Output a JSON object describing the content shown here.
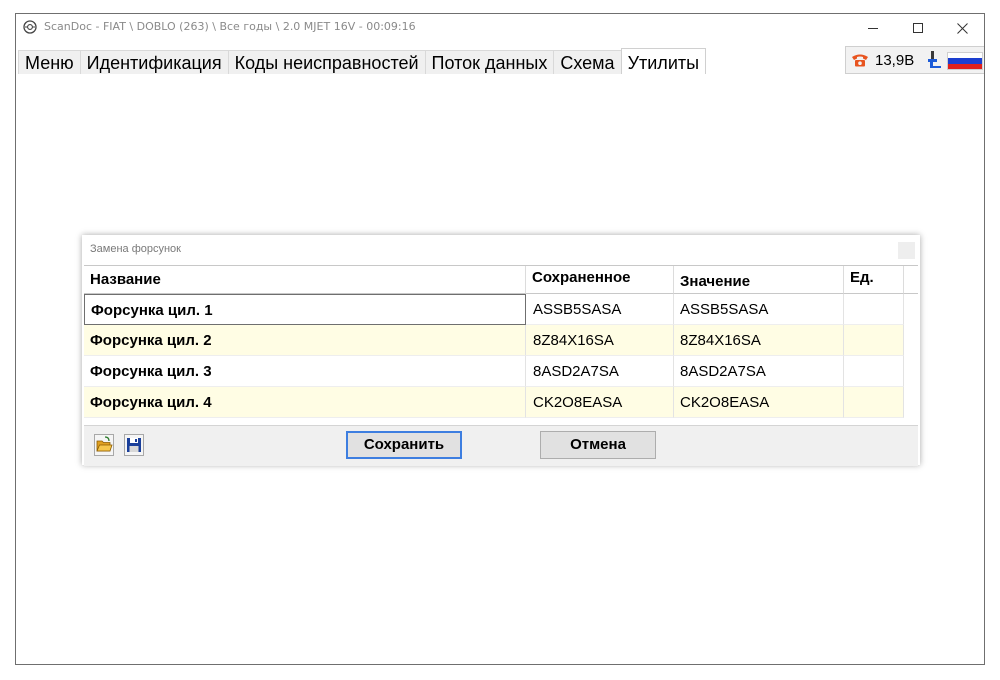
{
  "window": {
    "title": "ScanDoc - FIAT \\ DOBLO (263) \\ Все годы \\ 2.0 MJET 16V - 00:09:16"
  },
  "tabs": [
    {
      "label": "Меню"
    },
    {
      "label": "Идентификация"
    },
    {
      "label": "Коды неисправностей"
    },
    {
      "label": "Поток данных"
    },
    {
      "label": "Схема"
    },
    {
      "label": "Утилиты",
      "active": true
    }
  ],
  "status": {
    "voltage": "13,9В",
    "icons": [
      "phone-icon",
      "plug-icon",
      "russia-flag-icon"
    ]
  },
  "dialog": {
    "title": "Замена форсунок",
    "columns": [
      "Название",
      "Сохраненное",
      "Значение",
      "Ед."
    ],
    "rows": [
      {
        "name": "Форсунка цил. 1",
        "saved": "ASSB5SASA",
        "value": "ASSB5SASA",
        "unit": ""
      },
      {
        "name": "Форсунка цил. 2",
        "saved": "8Z84X16SA",
        "value": "8Z84X16SA",
        "unit": ""
      },
      {
        "name": "Форсунка цил. 3",
        "saved": "8ASD2A7SA",
        "value": "8ASD2A7SA",
        "unit": ""
      },
      {
        "name": "Форсунка цил. 4",
        "saved": "CK2O8EASA",
        "value": "CK2O8EASA",
        "unit": ""
      }
    ],
    "save_label": "Сохранить",
    "cancel_label": "Отмена",
    "footer_icons": [
      "open-folder-icon",
      "save-disk-icon"
    ]
  },
  "colors": {
    "alt_row": "#fffde4",
    "accent_border": "#3d7ee0",
    "phone": "#e8541f",
    "flag": [
      "#ffffff",
      "#1c3fd0",
      "#e0201c"
    ]
  }
}
